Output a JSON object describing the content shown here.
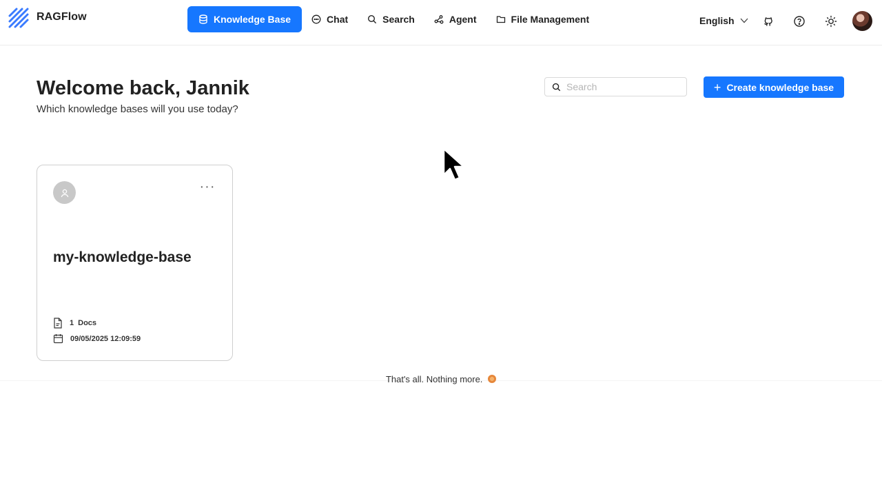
{
  "header": {
    "app_name": "RAGFlow",
    "nav": [
      {
        "label": "Knowledge Base",
        "icon": "database-icon",
        "active": true
      },
      {
        "label": "Chat",
        "icon": "chat-bubble-icon",
        "active": false
      },
      {
        "label": "Search",
        "icon": "search-icon",
        "active": false
      },
      {
        "label": "Agent",
        "icon": "agent-graph-icon",
        "active": false
      },
      {
        "label": "File Management",
        "icon": "folder-icon",
        "active": false
      }
    ],
    "language": "English",
    "tools": [
      "github-icon",
      "help-icon",
      "theme-sun-icon"
    ]
  },
  "main": {
    "welcome": "Welcome back, Jannik",
    "subtitle": "Which knowledge bases will you use today?",
    "search_placeholder": "Search",
    "create_label": "Create knowledge base"
  },
  "cards": [
    {
      "title": "my-knowledge-base",
      "docs_count": "1",
      "docs_label": "Docs",
      "date": "09/05/2025 12:09:59"
    }
  ],
  "footer_note": "That's all. Nothing more.",
  "colors": {
    "accent": "#1677ff",
    "text": "#222222",
    "border": "#cfcfcf"
  }
}
